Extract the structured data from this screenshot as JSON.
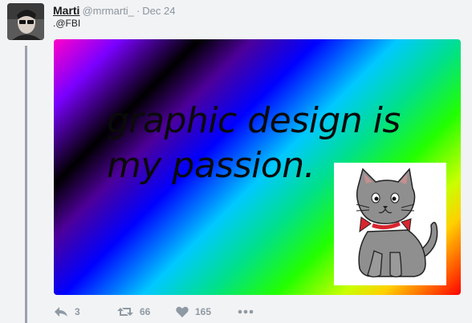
{
  "tweet": {
    "author_name": "Marti",
    "handle": "@mrmarti_",
    "separator": "·",
    "date": "Dec 24",
    "text": ".@FBI",
    "media": {
      "caption_line1": "graphic design is",
      "caption_line2": "my passion."
    },
    "actions": {
      "reply_count": "3",
      "retweet_count": "66",
      "like_count": "165",
      "reply_icon": "reply-icon",
      "retweet_icon": "retweet-icon",
      "like_icon": "heart-icon",
      "more_icon": "more-dots-icon"
    }
  },
  "colors": {
    "action_gray": "#8f99a3",
    "thread_line": "#9aa3ab",
    "background": "#f2f3f5"
  }
}
